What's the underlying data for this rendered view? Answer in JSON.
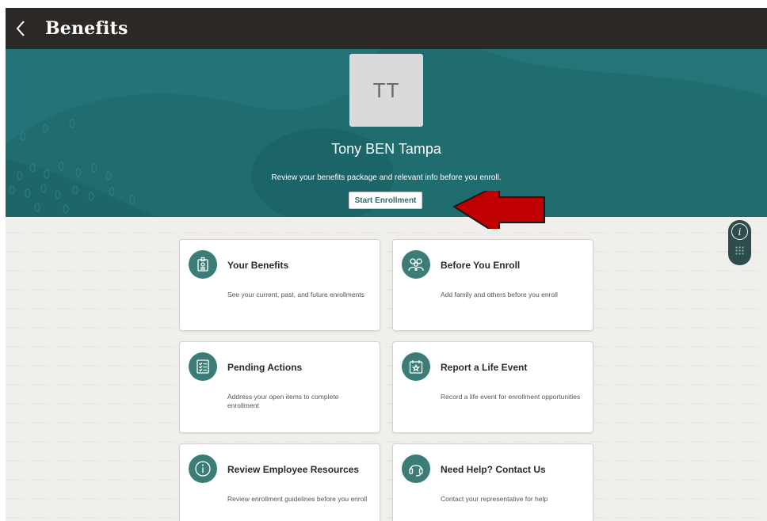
{
  "header": {
    "title": "Benefits"
  },
  "hero": {
    "avatar_initials": "TT",
    "user_name": "Tony BEN Tampa",
    "subtitle": "Review your benefits package and relevant info before you enroll.",
    "enroll_button": "Start Enrollment"
  },
  "cards": [
    {
      "title": "Your Benefits",
      "description": "See your current, past, and future enrollments",
      "icon": "benefits-badge-icon"
    },
    {
      "title": "Before You Enroll",
      "description": "Add family and others before you enroll",
      "icon": "family-icon"
    },
    {
      "title": "Pending Actions",
      "description": "Address your open items to complete enrollment",
      "icon": "checklist-icon"
    },
    {
      "title": "Report a Life Event",
      "description": "Record a life event for enrollment opportunities",
      "icon": "calendar-star-icon"
    },
    {
      "title": "Review Employee Resources",
      "description": "Review enrollment guidelines before you enroll",
      "icon": "info-icon"
    },
    {
      "title": "Need Help? Contact Us",
      "description": "Contact your representative for help",
      "icon": "headset-icon"
    }
  ],
  "colors": {
    "topbar": "#2b2826",
    "hero": "#1f6d6f",
    "icon_circle": "#3b7d76",
    "arrow": "#c00000"
  }
}
